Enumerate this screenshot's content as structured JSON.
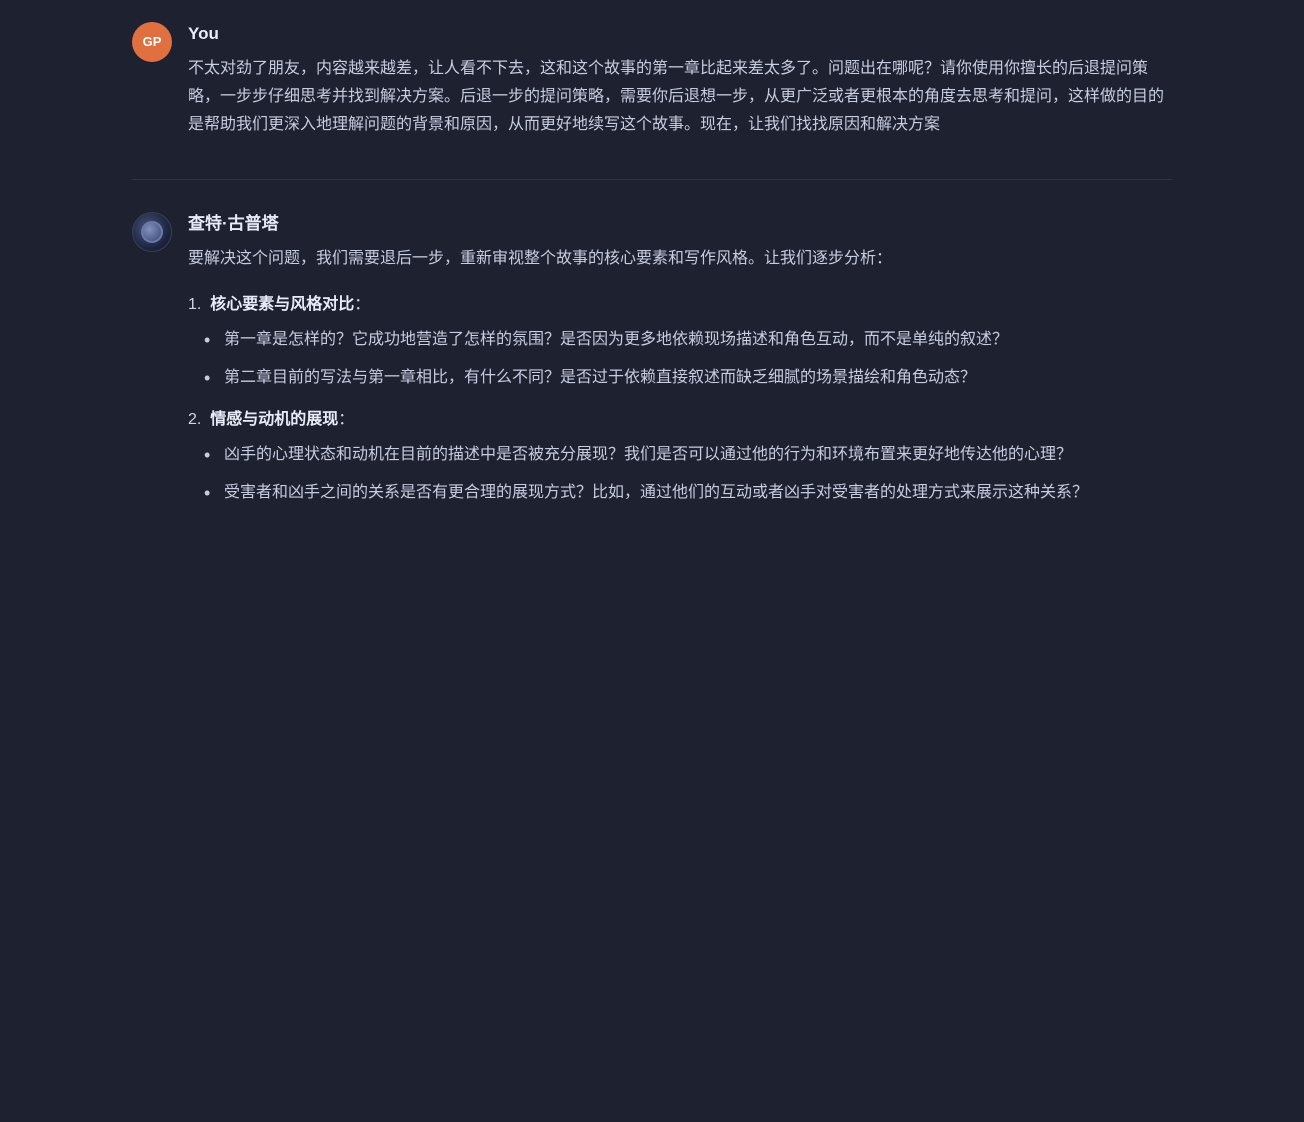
{
  "user": {
    "name": "You",
    "avatar_initials": "GP",
    "message": "不太对劲了朋友，内容越来越差，让人看不下去，这和这个故事的第一章比起来差太多了。问题出在哪呢？请你使用你擅长的后退提问策略，一步步仔细思考并找到解决方案。后退一步的提问策略，需要你后退想一步，从更广泛或者更根本的角度去思考和提问，这样做的目的是帮助我们更深入地理解问题的背景和原因，从而更好地续写这个故事。现在，让我们找找原因和解决方案"
  },
  "bot": {
    "name": "查特·古普塔",
    "intro": "要解决这个问题，我们需要退后一步，重新审视整个故事的核心要素和写作风格。让我们逐步分析：",
    "sections": [
      {
        "number": "1.",
        "title": "核心要素与风格对比",
        "bullets": [
          "第一章是怎样的？它成功地营造了怎样的氛围？是否因为更多地依赖现场描述和角色互动，而不是单纯的叙述？",
          "第二章目前的写法与第一章相比，有什么不同？是否过于依赖直接叙述而缺乏细腻的场景描绘和角色动态？"
        ]
      },
      {
        "number": "2.",
        "title": "情感与动机的展现",
        "bullets": [
          "凶手的心理状态和动机在目前的描述中是否被充分展现？我们是否可以通过他的行为和环境布置来更好地传达他的心理？",
          "受害者和凶手之间的关系是否有更合理的展现方式？比如，通过他们的互动或者凶手对受害者的处理方式来展示这种关系？"
        ]
      }
    ]
  }
}
